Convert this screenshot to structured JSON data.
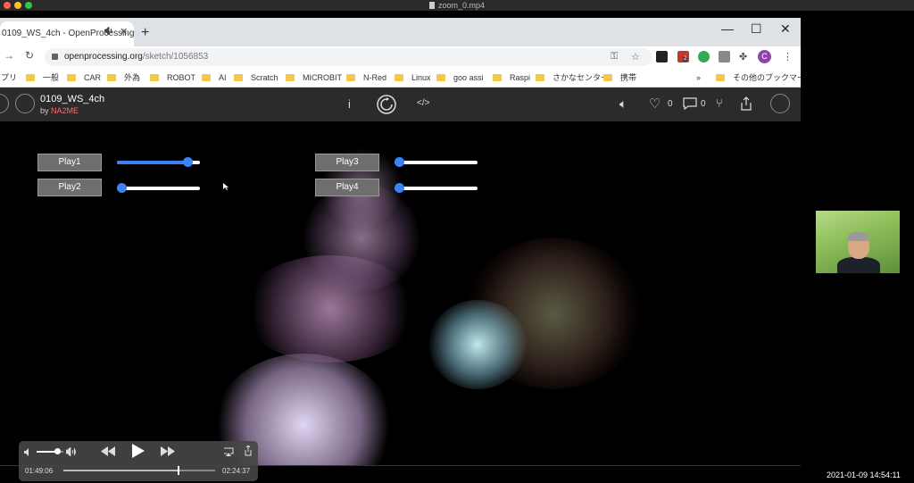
{
  "window": {
    "title": "zoom_0.mp4"
  },
  "browser": {
    "tab_title": "0109_WS_4ch - OpenProcessing",
    "new_tab": "+",
    "url_domain": "openprocessing.org",
    "url_path": "/sketch/1056853",
    "profile_initial": "C",
    "bookmarks": [
      "アプリ",
      "一般",
      "CAR",
      "外為",
      "ROBOT",
      "AI",
      "Scratch",
      "MICROBIT",
      "N-Red",
      "Linux",
      "goo assi",
      "Raspi",
      "さかなセンター",
      "携帯"
    ],
    "bookmarks_more": "»",
    "bookmarks_other": "その他のブックマーク",
    "extension_badge": "2"
  },
  "sketch_header": {
    "title": "0109_WS_4ch",
    "by_prefix": "by",
    "author": "NA2ME",
    "like_count": "0",
    "comment_count": "0"
  },
  "sketch": {
    "buttons": [
      "Play1",
      "Play2",
      "Play3",
      "Play4"
    ],
    "slider_values": [
      0.85,
      0.05,
      0.05,
      0.05
    ]
  },
  "player": {
    "elapsed": "01:49:06",
    "remaining": "02:24:37",
    "progress": 0.75,
    "volume": 0.75
  },
  "timestamp": "2021-01-09 14:54:11",
  "colors": {
    "slider_accent": "#3b82f6",
    "author": "#ff6b6b"
  }
}
